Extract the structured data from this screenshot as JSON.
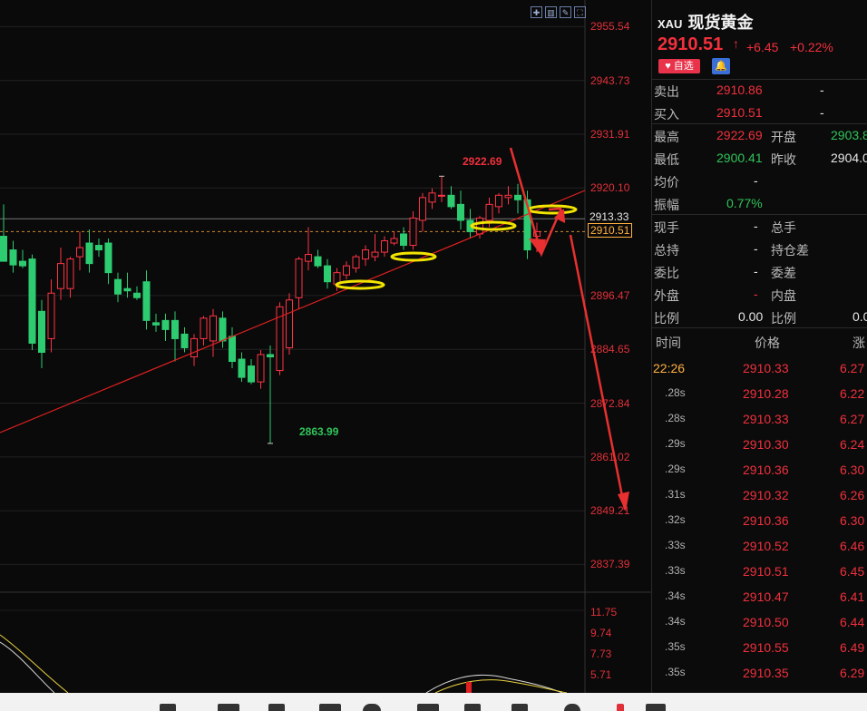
{
  "chart": {
    "y_axis_labels": [
      "2955.54",
      "2943.73",
      "2931.91",
      "2920.10",
      "2896.47",
      "2884.65",
      "2872.84",
      "2861.02",
      "2849.21",
      "2837.39"
    ],
    "level_tag_upper": "2913.33",
    "level_tag_price": "2910.51",
    "high_label": "2922.69",
    "low_label": "2863.99",
    "indicator_labels": [
      "11.75",
      "9.74",
      "7.73",
      "5.71"
    ],
    "up_color": "#ff3344",
    "down_color": "#2ecc71"
  },
  "chart_data": {
    "type": "candlestick",
    "y_range": [
      2831.5,
      2961.4
    ],
    "candles": [
      {
        "o": 2909.5,
        "h": 2916.5,
        "l": 2905.8,
        "c": 2904.0
      },
      {
        "o": 2906.5,
        "h": 2908.5,
        "l": 2901.5,
        "c": 2903.2
      },
      {
        "o": 2904.0,
        "h": 2906.5,
        "l": 2902.5,
        "c": 2903.0
      },
      {
        "o": 2904.5,
        "h": 2905.5,
        "l": 2884.5,
        "c": 2886.0
      },
      {
        "o": 2893.0,
        "h": 2895.5,
        "l": 2880.5,
        "c": 2884.0
      },
      {
        "o": 2887.0,
        "h": 2900.0,
        "l": 2884.0,
        "c": 2897.0
      },
      {
        "o": 2898.0,
        "h": 2907.0,
        "l": 2895.5,
        "c": 2903.5
      },
      {
        "o": 2898.0,
        "h": 2905.0,
        "l": 2896.0,
        "c": 2904.5
      },
      {
        "o": 2905.0,
        "h": 2910.5,
        "l": 2902.0,
        "c": 2907.0
      },
      {
        "o": 2908.0,
        "h": 2911.0,
        "l": 2901.5,
        "c": 2903.5
      },
      {
        "o": 2907.5,
        "h": 2909.0,
        "l": 2905.0,
        "c": 2906.5
      },
      {
        "o": 2908.0,
        "h": 2909.0,
        "l": 2899.0,
        "c": 2901.5
      },
      {
        "o": 2900.0,
        "h": 2901.5,
        "l": 2895.0,
        "c": 2896.8
      },
      {
        "o": 2898.0,
        "h": 2901.5,
        "l": 2896.0,
        "c": 2897.5
      },
      {
        "o": 2897.0,
        "h": 2898.5,
        "l": 2895.5,
        "c": 2896.0
      },
      {
        "o": 2899.5,
        "h": 2902.0,
        "l": 2889.0,
        "c": 2891.0
      },
      {
        "o": 2890.5,
        "h": 2892.5,
        "l": 2888.5,
        "c": 2890.0
      },
      {
        "o": 2891.0,
        "h": 2892.5,
        "l": 2886.5,
        "c": 2889.0
      },
      {
        "o": 2891.0,
        "h": 2893.0,
        "l": 2882.0,
        "c": 2887.0
      },
      {
        "o": 2888.0,
        "h": 2889.5,
        "l": 2884.0,
        "c": 2885.0
      },
      {
        "o": 2883.0,
        "h": 2888.0,
        "l": 2881.0,
        "c": 2887.0
      },
      {
        "o": 2887.0,
        "h": 2892.0,
        "l": 2885.5,
        "c": 2891.5
      },
      {
        "o": 2886.5,
        "h": 2893.5,
        "l": 2883.0,
        "c": 2892.0
      },
      {
        "o": 2891.5,
        "h": 2893.0,
        "l": 2885.0,
        "c": 2886.5
      },
      {
        "o": 2887.5,
        "h": 2889.5,
        "l": 2880.5,
        "c": 2882.0
      },
      {
        "o": 2882.5,
        "h": 2884.0,
        "l": 2877.5,
        "c": 2878.5
      },
      {
        "o": 2881.0,
        "h": 2882.5,
        "l": 2877.0,
        "c": 2877.5
      },
      {
        "o": 2877.5,
        "h": 2884.5,
        "l": 2876.0,
        "c": 2883.5
      },
      {
        "o": 2883.5,
        "h": 2885.5,
        "l": 2864.0,
        "c": 2883.0
      },
      {
        "o": 2880.0,
        "h": 2895.0,
        "l": 2879.0,
        "c": 2894.0
      },
      {
        "o": 2885.0,
        "h": 2897.0,
        "l": 2883.5,
        "c": 2895.5
      },
      {
        "o": 2896.0,
        "h": 2905.0,
        "l": 2893.5,
        "c": 2904.5
      },
      {
        "o": 2904.0,
        "h": 2911.5,
        "l": 2902.0,
        "c": 2905.5
      },
      {
        "o": 2905.0,
        "h": 2906.5,
        "l": 2902.5,
        "c": 2903.0
      },
      {
        "o": 2903.0,
        "h": 2904.5,
        "l": 2898.0,
        "c": 2899.5
      },
      {
        "o": 2899.0,
        "h": 2902.5,
        "l": 2897.5,
        "c": 2901.5
      },
      {
        "o": 2901.0,
        "h": 2904.0,
        "l": 2900.0,
        "c": 2903.0
      },
      {
        "o": 2902.5,
        "h": 2905.5,
        "l": 2901.5,
        "c": 2905.0
      },
      {
        "o": 2904.5,
        "h": 2907.5,
        "l": 2903.0,
        "c": 2906.5
      },
      {
        "o": 2905.0,
        "h": 2910.0,
        "l": 2904.0,
        "c": 2906.0
      },
      {
        "o": 2906.0,
        "h": 2909.5,
        "l": 2905.0,
        "c": 2908.5
      },
      {
        "o": 2908.0,
        "h": 2910.5,
        "l": 2907.5,
        "c": 2909.0
      },
      {
        "o": 2910.0,
        "h": 2911.5,
        "l": 2906.5,
        "c": 2907.5
      },
      {
        "o": 2907.5,
        "h": 2915.0,
        "l": 2906.5,
        "c": 2913.5
      },
      {
        "o": 2913.0,
        "h": 2919.0,
        "l": 2910.5,
        "c": 2918.0
      },
      {
        "o": 2917.0,
        "h": 2920.0,
        "l": 2915.5,
        "c": 2919.0
      },
      {
        "o": 2918.5,
        "h": 2922.7,
        "l": 2917.0,
        "c": 2918.5
      },
      {
        "o": 2918.5,
        "h": 2920.5,
        "l": 2915.5,
        "c": 2916.0
      },
      {
        "o": 2916.5,
        "h": 2919.5,
        "l": 2911.0,
        "c": 2913.0
      },
      {
        "o": 2913.0,
        "h": 2915.5,
        "l": 2909.0,
        "c": 2910.5
      },
      {
        "o": 2910.0,
        "h": 2914.0,
        "l": 2909.0,
        "c": 2913.5
      },
      {
        "o": 2913.0,
        "h": 2918.0,
        "l": 2911.5,
        "c": 2916.5
      },
      {
        "o": 2916.0,
        "h": 2919.0,
        "l": 2914.5,
        "c": 2918.5
      },
      {
        "o": 2918.0,
        "h": 2920.5,
        "l": 2916.5,
        "c": 2918.5
      },
      {
        "o": 2918.5,
        "h": 2921.0,
        "l": 2914.5,
        "c": 2917.5
      },
      {
        "o": 2917.5,
        "h": 2919.5,
        "l": 2904.5,
        "c": 2906.5
      },
      {
        "o": 2909.5,
        "h": 2912.5,
        "l": 2906.0,
        "c": 2910.5
      }
    ],
    "annotations": {
      "high": "2922.69",
      "low": "2863.99"
    }
  },
  "panel": {
    "code": "XAU",
    "name": "现货黄金",
    "price": "2910.51",
    "arrow": "↑",
    "change": "+6.45",
    "change_pct": "+0.22%",
    "fav_label": "自选",
    "sell_label": "卖出",
    "sell_value": "2910.86",
    "sell_vol": "-",
    "buy_label": "买入",
    "buy_value": "2910.51",
    "buy_vol": "-",
    "high_label": "最高",
    "high_value": "2922.69",
    "open_label": "开盘",
    "open_value": "2903.8",
    "low_label": "最低",
    "low_value": "2900.41",
    "prev_label": "昨收",
    "prev_value": "2904.0",
    "avg_label": "均价",
    "avg_value": "-",
    "amp_label": "振幅",
    "amp_value": "0.77%",
    "cur_label": "现手",
    "cur_value": "-",
    "total_label": "总手",
    "hold_label": "总持",
    "hold_value": "-",
    "holddiff_label": "持仓差",
    "wb_label": "委比",
    "wb_value": "-",
    "wc_label": "委差",
    "outer_label": "外盘",
    "outer_value": "-",
    "inner_label": "内盘",
    "ratio_label": "比例",
    "ratio_value": "0.00",
    "ratio2_label": "比例",
    "ratio2_value": "0.0",
    "ticks_header": {
      "time": "时间",
      "price": "价格",
      "chg": "涨"
    },
    "ticks": [
      {
        "t": "22:26",
        "p": "2910.33",
        "c": "6.27"
      },
      {
        "t": ".28s",
        "p": "2910.28",
        "c": "6.22"
      },
      {
        "t": ".28s",
        "p": "2910.33",
        "c": "6.27"
      },
      {
        "t": ".29s",
        "p": "2910.30",
        "c": "6.24"
      },
      {
        "t": ".29s",
        "p": "2910.36",
        "c": "6.30"
      },
      {
        "t": ".31s",
        "p": "2910.32",
        "c": "6.26"
      },
      {
        "t": ".32s",
        "p": "2910.36",
        "c": "6.30"
      },
      {
        "t": ".33s",
        "p": "2910.52",
        "c": "6.46"
      },
      {
        "t": ".33s",
        "p": "2910.51",
        "c": "6.45"
      },
      {
        "t": ".34s",
        "p": "2910.47",
        "c": "6.41"
      },
      {
        "t": ".34s",
        "p": "2910.50",
        "c": "6.44"
      },
      {
        "t": ".35s",
        "p": "2910.55",
        "c": "6.49"
      },
      {
        "t": ".35s",
        "p": "2910.35",
        "c": "6.29"
      }
    ]
  }
}
